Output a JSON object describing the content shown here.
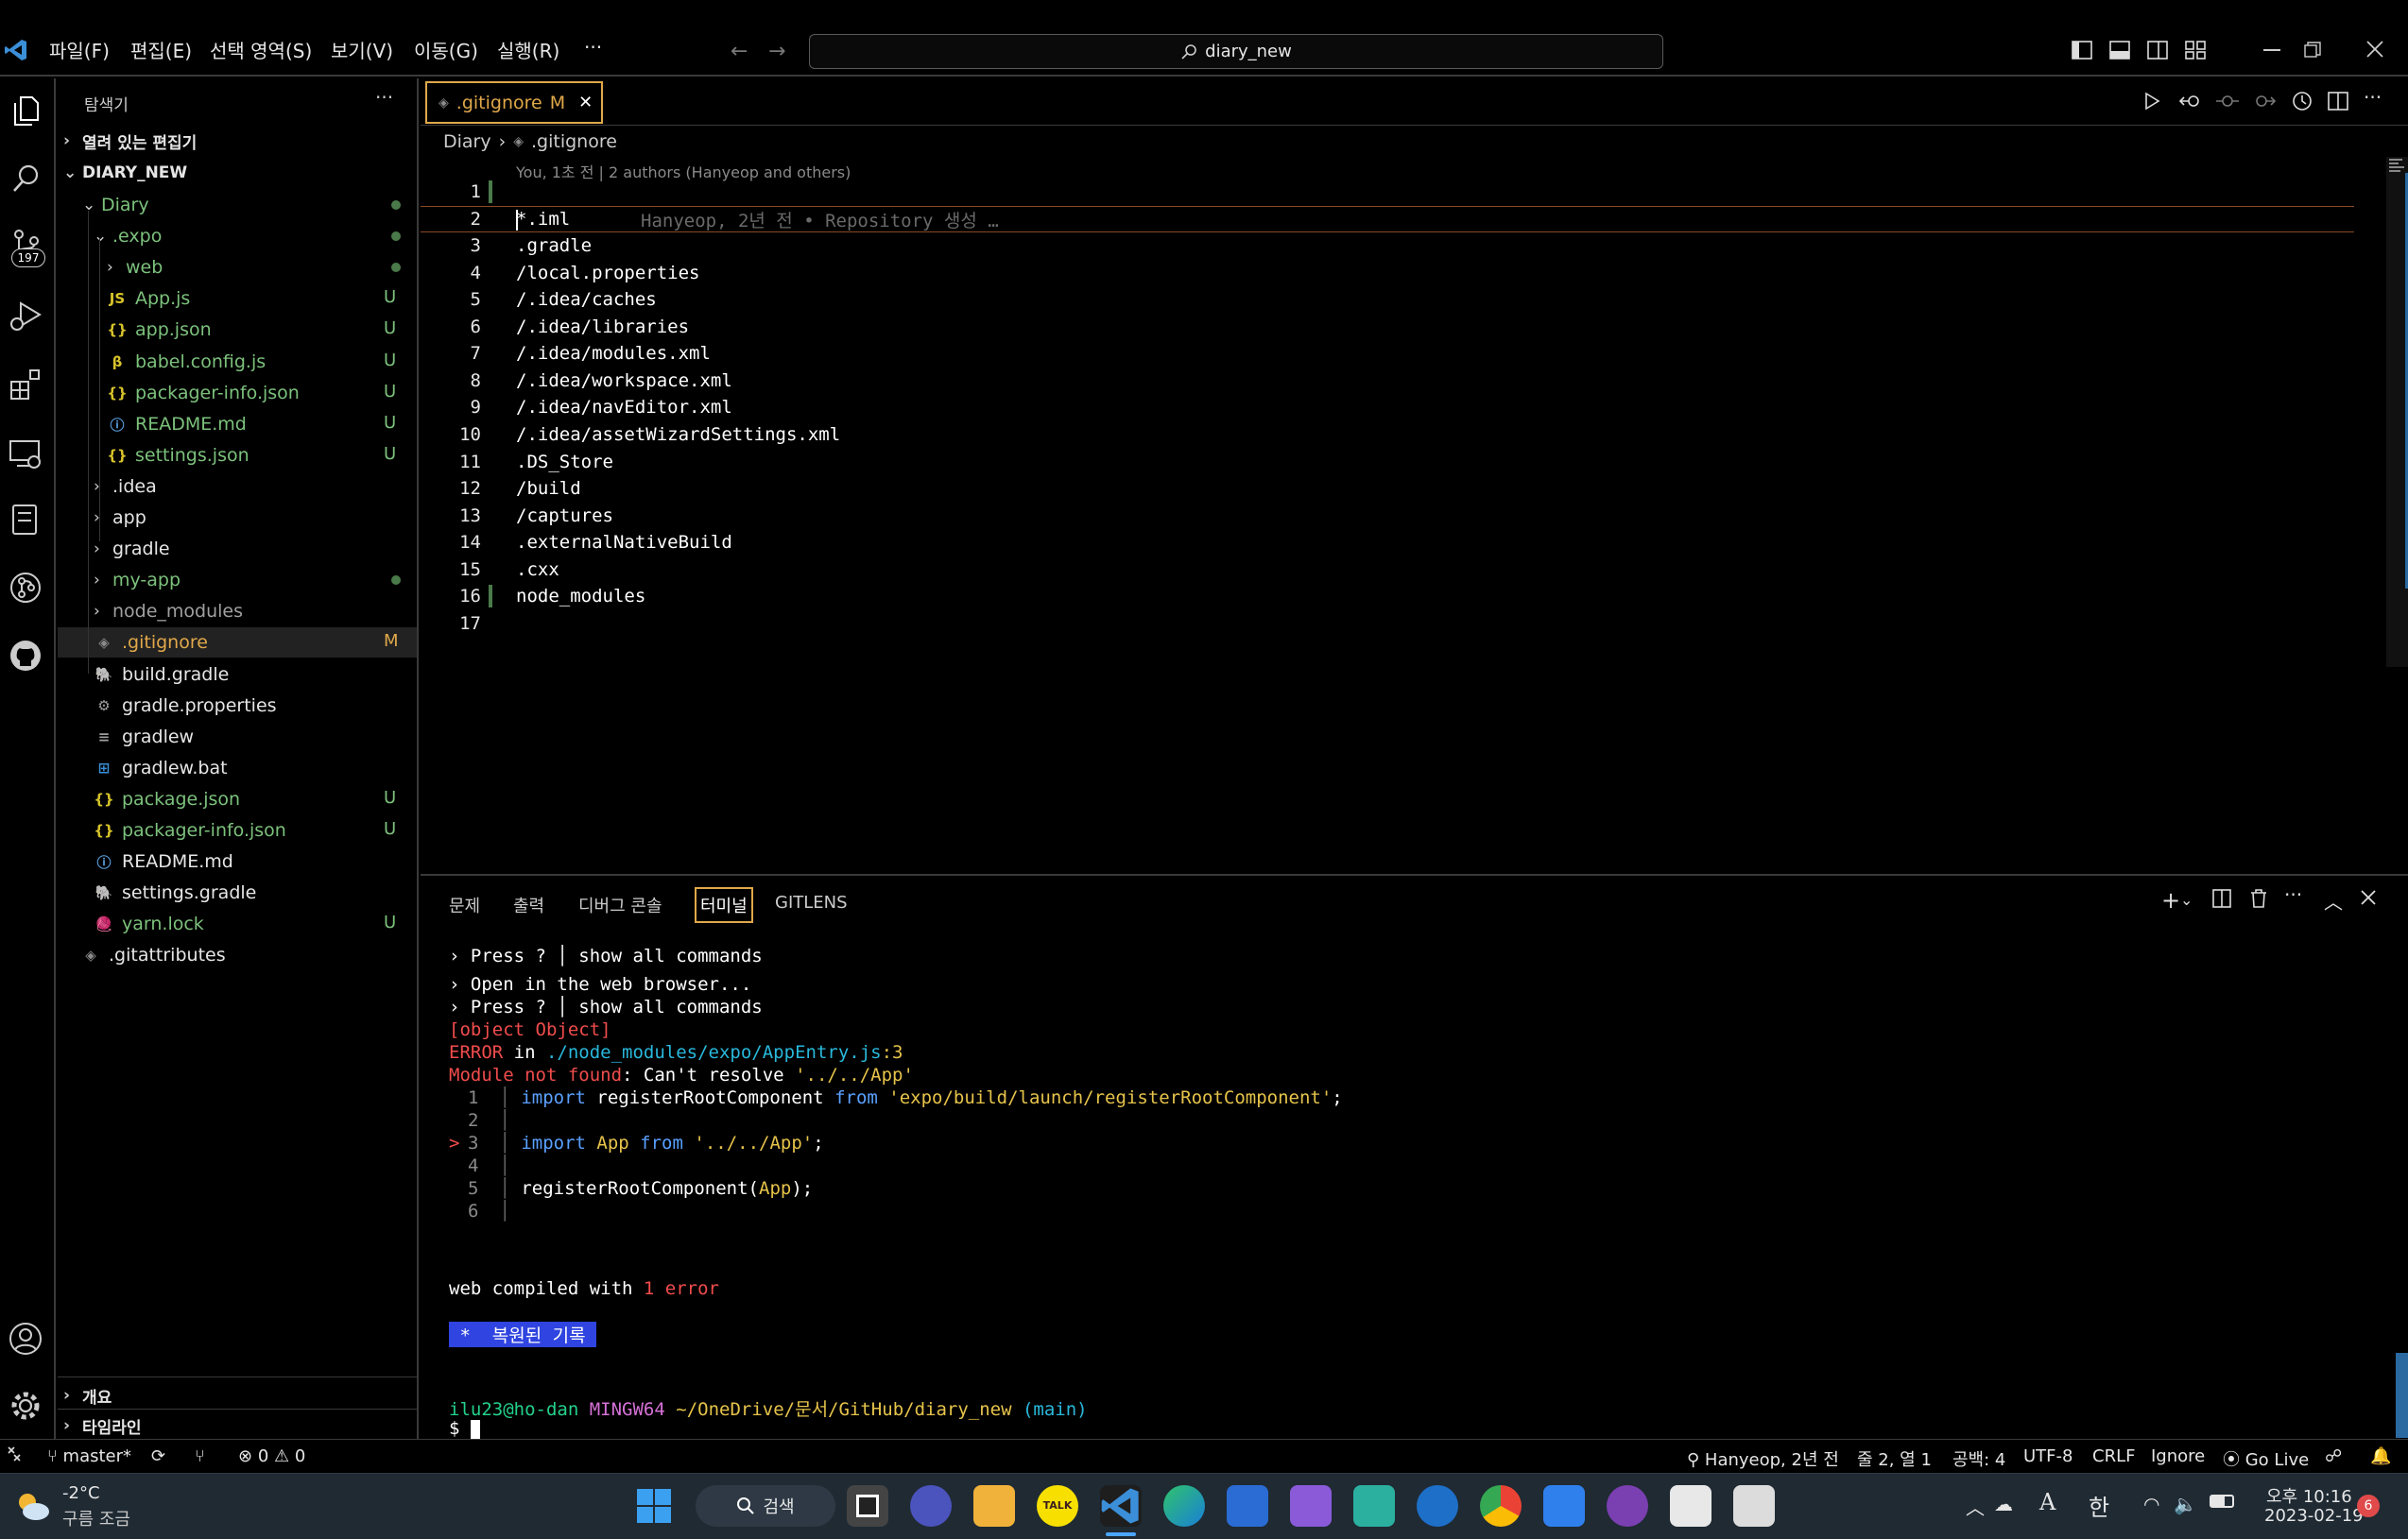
{
  "titlebar": {
    "menus": [
      "파일(F)",
      "편집(E)",
      "선택 영역(S)",
      "보기(V)",
      "이동(G)",
      "실행(R)",
      "···"
    ],
    "search_text": "diary_new"
  },
  "activity": {
    "scm_badge": "197"
  },
  "sidebar": {
    "title": "탐색기",
    "more": "···",
    "open_editors": "열려 있는 편집기",
    "root": "DIARY_NEW",
    "items": [
      {
        "label": "Diary",
        "chev": "⌄",
        "icon": "",
        "color": "#7cc17c",
        "badge": "dot"
      },
      {
        "label": ".expo",
        "chev": "⌄",
        "icon": "",
        "color": "#7cc17c",
        "badge": "dot"
      },
      {
        "label": "web",
        "chev": "›",
        "icon": "",
        "color": "#7cc17c",
        "badge": "dot"
      },
      {
        "label": "App.js",
        "chev": "",
        "icon": "JS",
        "iconColor": "#d7c32b",
        "color": "#7cc17c",
        "badge": "U"
      },
      {
        "label": "app.json",
        "chev": "",
        "icon": "{}",
        "iconColor": "#d7c32b",
        "color": "#7cc17c",
        "badge": "U"
      },
      {
        "label": "babel.config.js",
        "chev": "",
        "icon": "β",
        "iconColor": "#d7c32b",
        "color": "#7cc17c",
        "badge": "U"
      },
      {
        "label": "packager-info.json",
        "chev": "",
        "icon": "{}",
        "iconColor": "#d7c32b",
        "color": "#7cc17c",
        "badge": "U"
      },
      {
        "label": "README.md",
        "chev": "",
        "icon": "ⓘ",
        "iconColor": "#5aa0e0",
        "color": "#7cc17c",
        "badge": "U"
      },
      {
        "label": "settings.json",
        "chev": "",
        "icon": "{}",
        "iconColor": "#d7c32b",
        "color": "#7cc17c",
        "badge": "U"
      },
      {
        "label": ".idea",
        "chev": "›",
        "icon": "",
        "color": "#e6e6e6",
        "badge": ""
      },
      {
        "label": "app",
        "chev": "›",
        "icon": "",
        "color": "#e6e6e6",
        "badge": ""
      },
      {
        "label": "gradle",
        "chev": "›",
        "icon": "",
        "color": "#e6e6e6",
        "badge": ""
      },
      {
        "label": "my-app",
        "chev": "›",
        "icon": "",
        "color": "#7cc17c",
        "badge": "dot"
      },
      {
        "label": "node_modules",
        "chev": "›",
        "icon": "",
        "color": "#a0a0a0",
        "badge": ""
      },
      {
        "label": ".gitignore",
        "chev": "",
        "icon": "◈",
        "iconColor": "#8a8a8a",
        "color": "#e0a84a",
        "badge": "M"
      },
      {
        "label": "build.gradle",
        "chev": "",
        "icon": "🐘",
        "iconColor": "#4a9ac0",
        "color": "#e6e6e6",
        "badge": ""
      },
      {
        "label": "gradle.properties",
        "chev": "",
        "icon": "⚙",
        "iconColor": "#a0a0a0",
        "color": "#e6e6e6",
        "badge": ""
      },
      {
        "label": "gradlew",
        "chev": "",
        "icon": "≡",
        "iconColor": "#a0a0a0",
        "color": "#e6e6e6",
        "badge": ""
      },
      {
        "label": "gradlew.bat",
        "chev": "",
        "icon": "⊞",
        "iconColor": "#3b8fd8",
        "color": "#e6e6e6",
        "badge": ""
      },
      {
        "label": "package.json",
        "chev": "",
        "icon": "{}",
        "iconColor": "#d7c32b",
        "color": "#7cc17c",
        "badge": "U"
      },
      {
        "label": "packager-info.json",
        "chev": "",
        "icon": "{}",
        "iconColor": "#d7c32b",
        "color": "#7cc17c",
        "badge": "U"
      },
      {
        "label": "README.md",
        "chev": "",
        "icon": "ⓘ",
        "iconColor": "#5aa0e0",
        "color": "#e6e6e6",
        "badge": ""
      },
      {
        "label": "settings.gradle",
        "chev": "",
        "icon": "🐘",
        "iconColor": "#4a9ac0",
        "color": "#e6e6e6",
        "badge": ""
      },
      {
        "label": "yarn.lock",
        "chev": "",
        "icon": "🧶",
        "iconColor": "#3a8fd0",
        "color": "#7cc17c",
        "badge": "U"
      },
      {
        "label": ".gitattributes",
        "chev": "",
        "icon": "◈",
        "iconColor": "#8a8a8a",
        "color": "#e6e6e6",
        "badge": ""
      }
    ],
    "outline": "개요",
    "timeline": "타임라인"
  },
  "editor": {
    "tab_label": ".gitignore",
    "tab_status": "M",
    "breadcrumb": [
      ".gitignore"
    ],
    "breadcrumb_root": "Diary",
    "codelens": "You, 1초 전 | 2 authors (Hanyeop and others)",
    "blame": "Hanyeop, 2년 전 • Repository 생성 …",
    "lines": [
      "",
      "*.iml",
      ".gradle",
      "/local.properties",
      "/.idea/caches",
      "/.idea/libraries",
      "/.idea/modules.xml",
      "/.idea/workspace.xml",
      "/.idea/navEditor.xml",
      "/.idea/assetWizardSettings.xml",
      ".DS_Store",
      "/build",
      "/captures",
      ".externalNativeBuild",
      ".cxx",
      "node_modules",
      ""
    ],
    "line_numbers": [
      "1",
      "2",
      "3",
      "4",
      "5",
      "6",
      "7",
      "8",
      "9",
      "10",
      "11",
      "12",
      "13",
      "14",
      "15",
      "16",
      "17"
    ]
  },
  "panel": {
    "tabs": [
      "문제",
      "출력",
      "디버그 콘솔",
      "터미널",
      "GITLENS"
    ],
    "active_tab": "터미널"
  },
  "terminal": {
    "press1": "› Press ? │ show all commands",
    "open_web": "› Open in the web browser...",
    "press2": "› Press ? │ show all commands",
    "obj": "[object Object]",
    "err_label": "ERROR",
    "err_in": " in ",
    "err_path": "./node_modules/expo/AppEntry.js",
    "err_line": ":3",
    "mnf": "Module not found",
    "mnf_rest": ": Can't resolve ",
    "mnf_path": "'../../App'",
    "src": [
      {
        "n": "1",
        "mark": "",
        "parts": [
          [
            "import ",
            "#5aa0ff"
          ],
          [
            "registerRootComponent ",
            "#ffffff"
          ],
          [
            "from ",
            "#5aa0ff"
          ],
          [
            "'expo/build/launch/registerRootComponent'",
            "#e6c34a"
          ],
          [
            ";",
            "#ffffff"
          ]
        ]
      },
      {
        "n": "2",
        "mark": "",
        "parts": []
      },
      {
        "n": "3",
        "mark": ">",
        "parts": [
          [
            "import ",
            "#5aa0ff"
          ],
          [
            "App ",
            "#e6c34a"
          ],
          [
            "from ",
            "#5aa0ff"
          ],
          [
            "'../../App'",
            "#e6c34a"
          ],
          [
            ";",
            "#ffffff"
          ]
        ]
      },
      {
        "n": "4",
        "mark": "",
        "parts": []
      },
      {
        "n": "5",
        "mark": "",
        "parts": [
          [
            "registerRootComponent(",
            "#ffffff"
          ],
          [
            "App",
            "#e6c34a"
          ],
          [
            ");",
            "#ffffff"
          ]
        ]
      },
      {
        "n": "6",
        "mark": "",
        "parts": []
      }
    ],
    "compiled_pre": "web compiled with ",
    "compiled_num": "1 error",
    "restored": " *  복원된 기록 ",
    "prompt_user": "ilu23@ho-dan",
    "prompt_sys": "MINGW64",
    "prompt_path": "~/OneDrive/문서/GitHub/diary_new",
    "prompt_branch": "(main)",
    "prompt_sign": "$"
  },
  "statusbar": {
    "branch": "master*",
    "errors": "0",
    "warnings": "0",
    "blame": "Hanyeop, 2년 전",
    "position": "줄 2, 열 1",
    "spaces": "공백: 4",
    "encoding": "UTF-8",
    "eol": "CRLF",
    "language": "Ignore",
    "golive": "Go Live"
  },
  "taskbar": {
    "temp": "-2°C",
    "weather": "구름 조금",
    "search": "검색",
    "ime": "한",
    "time": "오후 10:16",
    "date": "2023-02-19",
    "notif": "6"
  },
  "colors": {
    "accent": "#e0a84a",
    "git_added": "#7cc17c",
    "error": "#f14c4c",
    "vscode_blue": "#3b8fd8"
  }
}
